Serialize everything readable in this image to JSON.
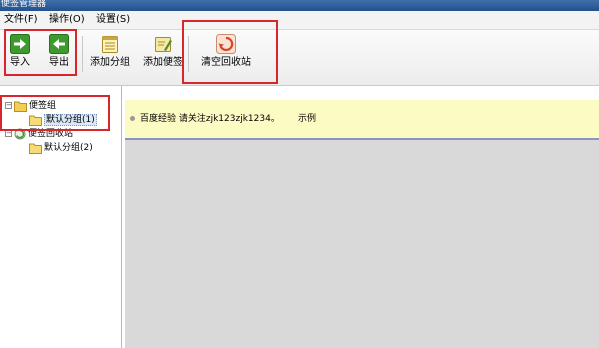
{
  "window": {
    "title": "便签管理器"
  },
  "menu": [
    {
      "label": "文件(F)"
    },
    {
      "label": "操作(O)"
    },
    {
      "label": "设置(S)"
    }
  ],
  "toolbar": {
    "import_label": "导入",
    "export_label": "导出",
    "add_group_label": "添加分组",
    "add_note_label": "添加便签",
    "empty_recycle_label": "清空回收站"
  },
  "tree": {
    "notes_group": "便签组",
    "notes_default": "默认分组(1)",
    "recycle_bin": "便签回收站",
    "recycle_default": "默认分组(2)"
  },
  "notes": [
    {
      "text": "百度经验 请关注zjk123zjk1234。",
      "group": "示例"
    }
  ],
  "colors": {
    "highlight": "#d9262c",
    "note_bg": "#fcfbc3",
    "panel_gray": "#d9d9d9",
    "arrow_green": "#3e9a2e"
  }
}
